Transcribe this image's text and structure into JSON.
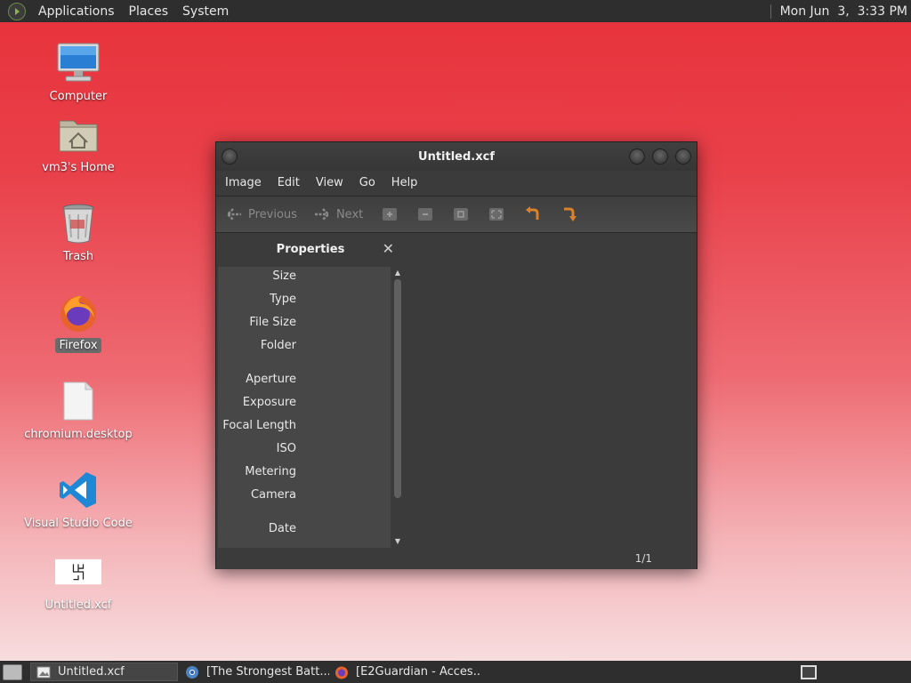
{
  "top_panel": {
    "menu": [
      "Applications",
      "Places",
      "System"
    ],
    "clock": "Mon Jun  3,  3:33 PM"
  },
  "desktop": {
    "icons": [
      {
        "label": "Computer",
        "icon": "computer-icon"
      },
      {
        "label": "vm3's Home",
        "icon": "home-folder-icon"
      },
      {
        "label": "Trash",
        "icon": "trash-icon"
      },
      {
        "label": "Firefox",
        "icon": "firefox-icon",
        "selected": true
      },
      {
        "label": "chromium.desktop",
        "icon": "document-icon"
      },
      {
        "label": "Visual Studio Code",
        "icon": "vscode-icon"
      },
      {
        "label": "Untitled.xcf",
        "icon": "image-thumbnail-icon"
      }
    ]
  },
  "window": {
    "title": "Untitled.xcf",
    "menu": [
      "Image",
      "Edit",
      "View",
      "Go",
      "Help"
    ],
    "toolbar": {
      "previous_label": "Previous",
      "next_label": "Next"
    },
    "properties": {
      "title": "Properties",
      "items": [
        "Size",
        "Type",
        "File Size",
        "Folder",
        "Aperture",
        "Exposure",
        "Focal Length",
        "ISO",
        "Metering",
        "Camera",
        "Date"
      ]
    },
    "status": {
      "page": "1/1"
    }
  },
  "taskbar": {
    "tasks": [
      {
        "label": "Untitled.xcf",
        "active": true
      },
      {
        "label": "[The Strongest Batt...",
        "active": false
      },
      {
        "label": "[E2Guardian - Acces...",
        "active": false
      }
    ]
  },
  "colors": {
    "panel": "#2e2e2e",
    "window_bg": "#3b3b3b",
    "list_bg": "#474747",
    "accent_orange": "#d9822b",
    "desktop_top": "#e8323a",
    "desktop_bottom": "#f8e4e5"
  }
}
